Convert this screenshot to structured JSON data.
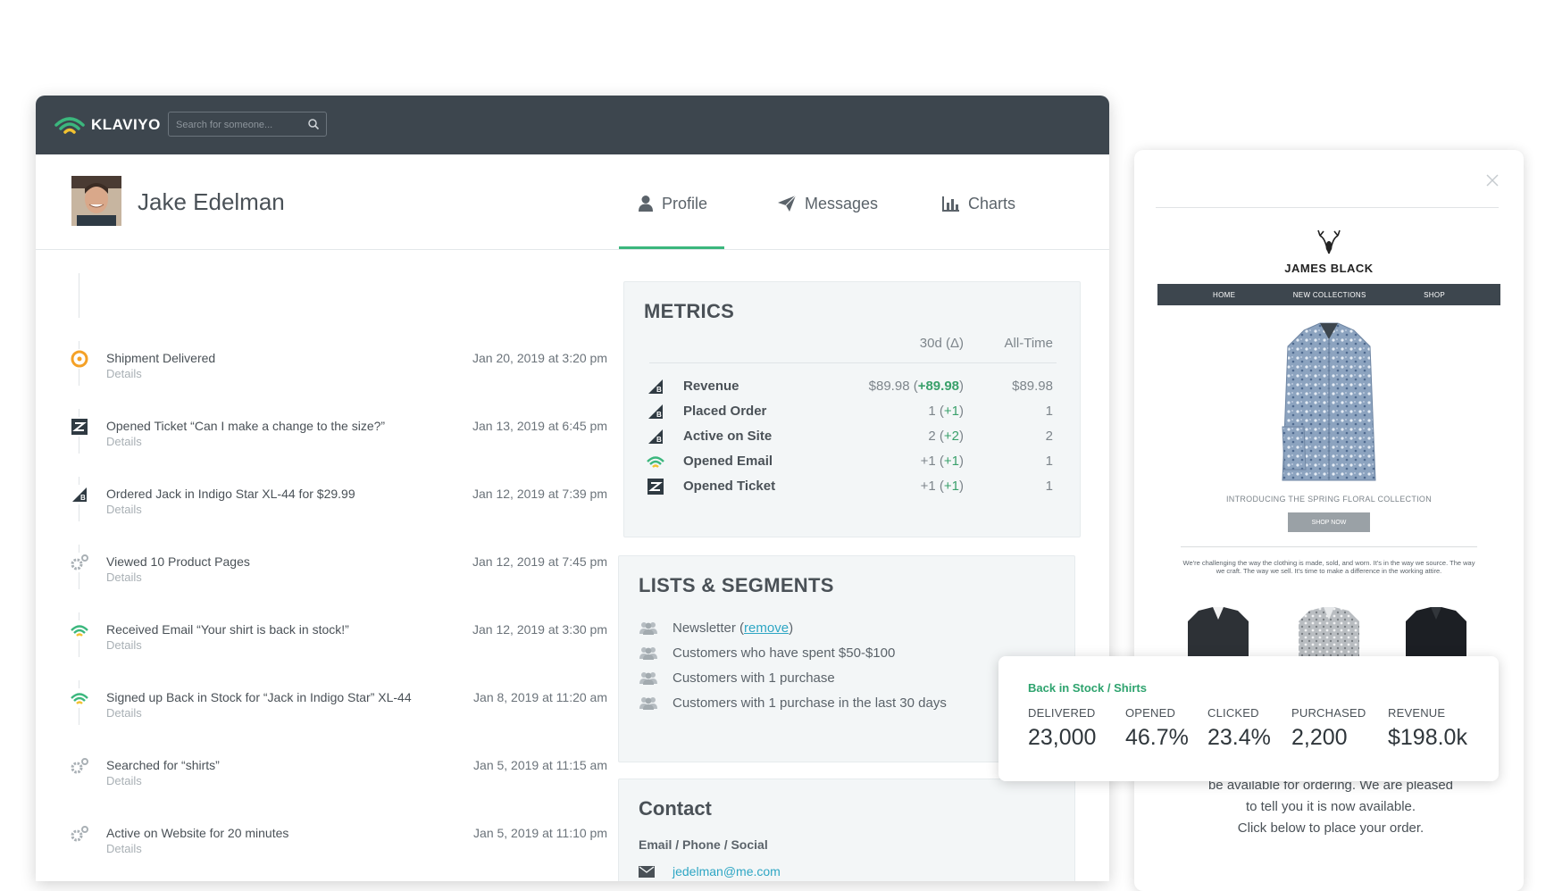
{
  "brand": {
    "logo_text": "KLAVIYO"
  },
  "search": {
    "placeholder": "Search for someone..."
  },
  "profile": {
    "name": "Jake Edelman"
  },
  "tabs": [
    {
      "label": "Profile",
      "icon": "user-icon",
      "active": true
    },
    {
      "label": "Messages",
      "icon": "paper-plane-icon",
      "active": false
    },
    {
      "label": "Charts",
      "icon": "bar-chart-icon",
      "active": false
    }
  ],
  "feed": [
    {
      "title": "Shipment Delivered",
      "details": "Details",
      "time": "Jan 20, 2019 at 3:20 pm",
      "icon": "shipment-icon"
    },
    {
      "title": "Opened Ticket “Can I make a change to the size?”",
      "details": "Details",
      "time": "Jan 13, 2019 at 6:45 pm",
      "icon": "zendesk-icon"
    },
    {
      "title": "Ordered Jack in Indigo Star XL-44 for $29.99",
      "details": "Details",
      "time": "Jan 12, 2019 at 7:39 pm",
      "icon": "bigcommerce-icon"
    },
    {
      "title": "Viewed 10 Product Pages",
      "details": "Details",
      "time": "Jan 12, 2019 at 7:45 pm",
      "icon": "gears-icon"
    },
    {
      "title": "Received Email “Your shirt is back in stock!”",
      "details": "Details",
      "time": "Jan 12, 2019 at 3:30 pm",
      "icon": "klaviyo-icon"
    },
    {
      "title": "Signed up Back in Stock for “Jack in Indigo Star” XL-44",
      "details": "Details",
      "time": "Jan 8, 2019 at 11:20 am",
      "icon": "klaviyo-icon"
    },
    {
      "title": "Searched for “shirts”",
      "details": "Details",
      "time": "Jan 5, 2019 at 11:15 am",
      "icon": "gears-icon"
    },
    {
      "title": "Active on Website for 20 minutes",
      "details": "Details",
      "time": "Jan 5, 2019 at 11:10 pm",
      "icon": "gears-icon"
    }
  ],
  "metrics": {
    "title": "METRICS",
    "col_30d": "30d (Δ)",
    "col_all": "All-Time",
    "rows": [
      {
        "label": "Revenue",
        "value_30d": "$89.98 (",
        "delta": "+89.98",
        "close": ")",
        "all_time": "$89.98",
        "icon": "bigcommerce-icon"
      },
      {
        "label": "Placed Order",
        "value_30d": "1 (",
        "delta": "+1",
        "close": ")",
        "all_time": "1",
        "icon": "bigcommerce-icon"
      },
      {
        "label": "Active on Site",
        "value_30d": "2 (",
        "delta": "+2",
        "close": ")",
        "all_time": "2",
        "icon": "bigcommerce-icon"
      },
      {
        "label": "Opened Email",
        "value_30d": "+1 (",
        "delta": "+1",
        "close": ")",
        "all_time": "1",
        "icon": "klaviyo-icon"
      },
      {
        "label": "Opened Ticket",
        "value_30d": "+1 (",
        "delta": "+1",
        "close": ")",
        "all_time": "1",
        "icon": "zendesk-icon"
      }
    ]
  },
  "lists": {
    "title": "LISTS & SEGMENTS",
    "items": [
      {
        "label": "Newsletter",
        "action": "remove"
      },
      {
        "label": "Customers who have spent $50-$100"
      },
      {
        "label": "Customers with 1 purchase"
      },
      {
        "label": "Customers with 1 purchase in the last 30 days"
      }
    ]
  },
  "contact": {
    "title": "Contact",
    "subtitle": "Email / Phone / Social",
    "email": "jedelman@me.com"
  },
  "email_preview": {
    "brand": "JAMES BLACK",
    "nav": [
      "HOME",
      "NEW COLLECTIONS",
      "SHOP"
    ],
    "collection_text": "INTRODUCING THE SPRING FLORAL COLLECTION",
    "shop_button": "SHOP NOW",
    "small_body": "We're challenging the way the clothing is made, sold, and worn. It's in the way we source. The way we craft. The way we sell. It's time to make a difference in the working attire.",
    "body_lines": [
      "be available for ordering. We are pleased",
      "to tell you it is now available.",
      "Click below to place your order."
    ]
  },
  "campaign": {
    "title": "Back in Stock / Shirts",
    "stats": [
      {
        "label": "DELIVERED",
        "value": "23,000"
      },
      {
        "label": "OPENED",
        "value": "46.7%"
      },
      {
        "label": "CLICKED",
        "value": "23.4%"
      },
      {
        "label": "PURCHASED",
        "value": "2,200"
      },
      {
        "label": "REVENUE",
        "value": "$198.0k"
      }
    ]
  },
  "colors": {
    "topbar": "#3d464e",
    "accent_green": "#3bb77d",
    "link": "#2ea6c4",
    "panel_bg": "#f3f6f7"
  }
}
